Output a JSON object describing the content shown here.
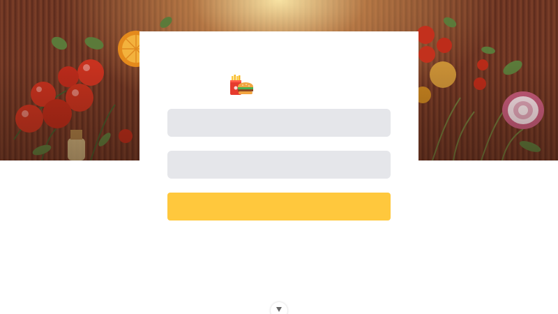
{
  "login": {
    "logo_icon": "fast-food-icon",
    "username_value": "",
    "password_value": "",
    "submit_label": ""
  },
  "scroll": {
    "icon": "chevron-down-icon"
  },
  "colors": {
    "accent": "#ffc83d",
    "field_bg": "#e5e6ea",
    "card_bg": "#ffffff",
    "hero_wood": "#6a3322"
  }
}
